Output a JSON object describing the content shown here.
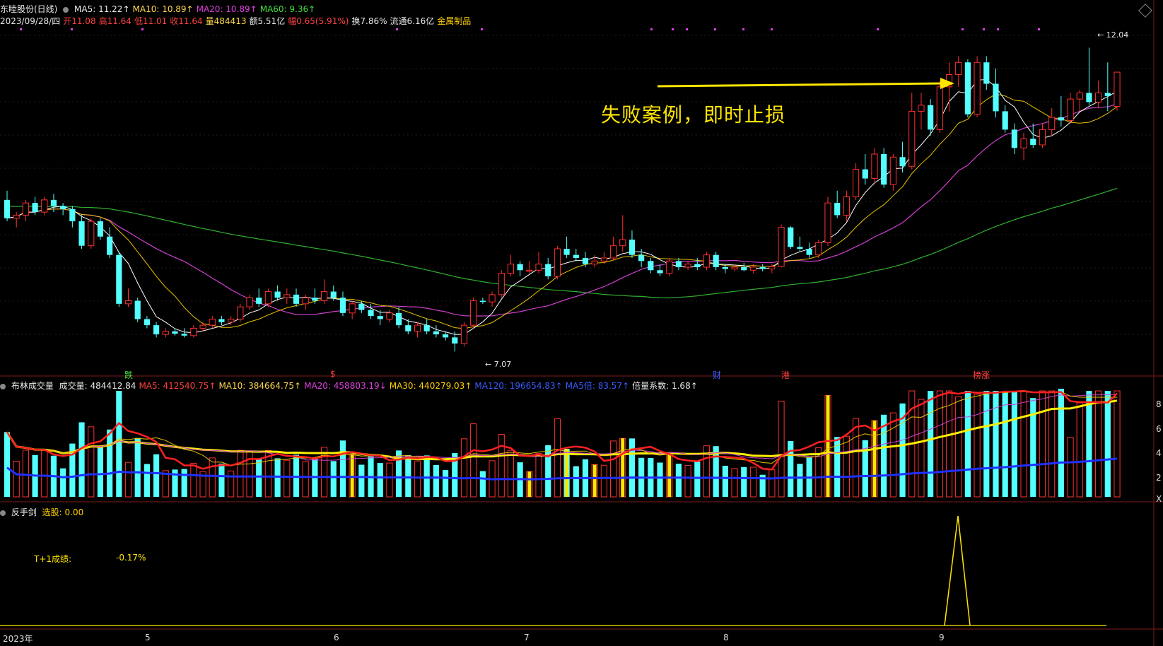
{
  "header": {
    "stock_title": "东睦股份(日线)",
    "ma_items": [
      {
        "label": "MA5: 11.22",
        "color": "#e8e8e8",
        "arrow": "↑"
      },
      {
        "label": "MA10: 10.89",
        "color": "#ffd84a",
        "arrow": "↑"
      },
      {
        "label": "MA20: 10.89",
        "color": "#e040e0",
        "arrow": "↑"
      },
      {
        "label": "MA60: 9.36",
        "color": "#40e040",
        "arrow": "↑"
      }
    ],
    "info_line": {
      "date": "2023/09/28/四",
      "open": "开11.08",
      "high": "高11.64",
      "low": "低11.01",
      "close": "收11.64",
      "volume": "量484413",
      "amount": "额5.51亿",
      "change": "幅0.65(5.91%)",
      "turnover": "换7.86%",
      "float": "流通6.16亿",
      "sector": "金属制品"
    }
  },
  "volume_header": {
    "name": "布林成交量",
    "items": [
      {
        "label": "成交量: 484412.84",
        "color": "#e8e8e8",
        "arrow": ""
      },
      {
        "label": "MA5: 412540.75",
        "color": "#ff4040",
        "arrow": "↑"
      },
      {
        "label": "MA10: 384664.75",
        "color": "#ffd84a",
        "arrow": "↑"
      },
      {
        "label": "MA20: 458803.19",
        "color": "#e040e0",
        "arrow": "↓"
      },
      {
        "label": "MA30: 440279.03",
        "color": "#ffd000",
        "arrow": "↑"
      },
      {
        "label": "MA120: 196654.83",
        "color": "#3a5cff",
        "arrow": "↑"
      },
      {
        "label": "MA5倍: 83.57",
        "color": "#3a5cff",
        "arrow": "↑"
      },
      {
        "label": "倍量系数: 1.68",
        "color": "#e8e8e8",
        "arrow": "↑"
      }
    ]
  },
  "indicator_header": {
    "name": "反手剑",
    "value": "选股: 0.00"
  },
  "annotation": "失败案例，即时止损",
  "performance": {
    "label": "T+1成绩:",
    "value": "-0.17%"
  },
  "price_marks": {
    "high": "12.04",
    "low": "7.07"
  },
  "event_tags": [
    {
      "text": "跌",
      "color": "#40e040"
    },
    {
      "text": "$",
      "color": "#ff4040"
    },
    {
      "text": "财",
      "color": "#3a5cff"
    },
    {
      "text": "港",
      "color": "#ff4040"
    },
    {
      "text": "榜涨",
      "color": "#ff4040"
    }
  ],
  "x_axis_labels": [
    "2023年",
    "5",
    "6",
    "7",
    "8",
    "9"
  ],
  "right_axis_labels": [
    "8",
    "6",
    "4",
    "2",
    "X"
  ],
  "colors": {
    "up": "#ff3030",
    "down": "#54ffff",
    "ma5": "#ffffff",
    "ma10": "#e8c400",
    "ma20": "#d040d0",
    "ma60": "#30b030",
    "annotation": "#ffe600"
  },
  "chart_data": {
    "type": "candlestick",
    "date_range": [
      "2023-04",
      "2023-09-28"
    ],
    "price_range": [
      7.07,
      12.04
    ],
    "last_close": 11.64,
    "candles": [
      {
        "o": 9.55,
        "h": 9.7,
        "l": 9.2,
        "c": 9.25
      },
      {
        "o": 9.25,
        "h": 9.35,
        "l": 9.1,
        "c": 9.3
      },
      {
        "o": 9.3,
        "h": 9.55,
        "l": 9.2,
        "c": 9.5
      },
      {
        "o": 9.5,
        "h": 9.6,
        "l": 9.3,
        "c": 9.35
      },
      {
        "o": 9.35,
        "h": 9.6,
        "l": 9.3,
        "c": 9.55
      },
      {
        "o": 9.55,
        "h": 9.65,
        "l": 9.35,
        "c": 9.45
      },
      {
        "o": 9.45,
        "h": 9.5,
        "l": 9.3,
        "c": 9.4
      },
      {
        "o": 9.4,
        "h": 9.45,
        "l": 9.1,
        "c": 9.2
      },
      {
        "o": 9.2,
        "h": 9.3,
        "l": 8.75,
        "c": 8.8
      },
      {
        "o": 8.8,
        "h": 9.25,
        "l": 8.75,
        "c": 9.2
      },
      {
        "o": 9.2,
        "h": 9.25,
        "l": 8.9,
        "c": 8.95
      },
      {
        "o": 8.95,
        "h": 9.1,
        "l": 8.6,
        "c": 8.65
      },
      {
        "o": 8.65,
        "h": 8.7,
        "l": 7.8,
        "c": 7.85
      },
      {
        "o": 7.85,
        "h": 8.1,
        "l": 7.8,
        "c": 7.9
      },
      {
        "o": 7.9,
        "h": 7.95,
        "l": 7.55,
        "c": 7.6
      },
      {
        "o": 7.6,
        "h": 7.65,
        "l": 7.45,
        "c": 7.5
      },
      {
        "o": 7.5,
        "h": 7.55,
        "l": 7.3,
        "c": 7.35
      },
      {
        "o": 7.35,
        "h": 7.45,
        "l": 7.3,
        "c": 7.4
      },
      {
        "o": 7.4,
        "h": 7.45,
        "l": 7.33,
        "c": 7.36
      },
      {
        "o": 7.36,
        "h": 7.45,
        "l": 7.3,
        "c": 7.33
      },
      {
        "o": 7.33,
        "h": 7.5,
        "l": 7.3,
        "c": 7.45
      },
      {
        "o": 7.45,
        "h": 7.55,
        "l": 7.4,
        "c": 7.5
      },
      {
        "o": 7.5,
        "h": 7.65,
        "l": 7.45,
        "c": 7.6
      },
      {
        "o": 7.6,
        "h": 7.65,
        "l": 7.5,
        "c": 7.55
      },
      {
        "o": 7.55,
        "h": 7.65,
        "l": 7.5,
        "c": 7.6
      },
      {
        "o": 7.6,
        "h": 7.85,
        "l": 7.55,
        "c": 7.8
      },
      {
        "o": 7.8,
        "h": 8.0,
        "l": 7.75,
        "c": 7.95
      },
      {
        "o": 7.95,
        "h": 8.1,
        "l": 7.8,
        "c": 7.85
      },
      {
        "o": 7.85,
        "h": 8.1,
        "l": 7.8,
        "c": 8.05
      },
      {
        "o": 8.05,
        "h": 8.15,
        "l": 7.9,
        "c": 7.95
      },
      {
        "o": 7.95,
        "h": 8.1,
        "l": 7.85,
        "c": 8.0
      },
      {
        "o": 8.0,
        "h": 8.1,
        "l": 7.8,
        "c": 7.85
      },
      {
        "o": 7.85,
        "h": 8.0,
        "l": 7.75,
        "c": 7.95
      },
      {
        "o": 7.95,
        "h": 8.1,
        "l": 7.85,
        "c": 7.9
      },
      {
        "o": 7.9,
        "h": 8.25,
        "l": 7.85,
        "c": 8.05
      },
      {
        "o": 8.05,
        "h": 8.15,
        "l": 7.9,
        "c": 7.95
      },
      {
        "o": 7.95,
        "h": 8.05,
        "l": 7.65,
        "c": 7.7
      },
      {
        "o": 7.7,
        "h": 7.9,
        "l": 7.6,
        "c": 7.85
      },
      {
        "o": 7.85,
        "h": 7.9,
        "l": 7.7,
        "c": 7.75
      },
      {
        "o": 7.75,
        "h": 7.85,
        "l": 7.6,
        "c": 7.65
      },
      {
        "o": 7.65,
        "h": 7.75,
        "l": 7.5,
        "c": 7.6
      },
      {
        "o": 7.6,
        "h": 7.75,
        "l": 7.55,
        "c": 7.7
      },
      {
        "o": 7.7,
        "h": 7.8,
        "l": 7.45,
        "c": 7.5
      },
      {
        "o": 7.5,
        "h": 7.6,
        "l": 7.35,
        "c": 7.4
      },
      {
        "o": 7.4,
        "h": 7.55,
        "l": 7.3,
        "c": 7.5
      },
      {
        "o": 7.5,
        "h": 7.6,
        "l": 7.35,
        "c": 7.4
      },
      {
        "o": 7.4,
        "h": 7.5,
        "l": 7.3,
        "c": 7.35
      },
      {
        "o": 7.35,
        "h": 7.4,
        "l": 7.25,
        "c": 7.3
      },
      {
        "o": 7.3,
        "h": 7.4,
        "l": 7.07,
        "c": 7.2
      },
      {
        "o": 7.2,
        "h": 7.55,
        "l": 7.15,
        "c": 7.5
      },
      {
        "o": 7.5,
        "h": 7.95,
        "l": 7.45,
        "c": 7.9
      },
      {
        "o": 7.9,
        "h": 7.95,
        "l": 7.85,
        "c": 7.88
      },
      {
        "o": 7.88,
        "h": 8.05,
        "l": 7.8,
        "c": 8.0
      },
      {
        "o": 8.0,
        "h": 8.4,
        "l": 7.95,
        "c": 8.35
      },
      {
        "o": 8.35,
        "h": 8.65,
        "l": 8.3,
        "c": 8.5
      },
      {
        "o": 8.5,
        "h": 8.55,
        "l": 8.3,
        "c": 8.4
      },
      {
        "o": 8.4,
        "h": 8.55,
        "l": 8.35,
        "c": 8.4
      },
      {
        "o": 8.4,
        "h": 8.7,
        "l": 8.35,
        "c": 8.5
      },
      {
        "o": 8.5,
        "h": 8.6,
        "l": 8.25,
        "c": 8.3
      },
      {
        "o": 8.3,
        "h": 8.8,
        "l": 8.25,
        "c": 8.75
      },
      {
        "o": 8.75,
        "h": 8.95,
        "l": 8.6,
        "c": 8.65
      },
      {
        "o": 8.65,
        "h": 8.75,
        "l": 8.55,
        "c": 8.6
      },
      {
        "o": 8.6,
        "h": 8.7,
        "l": 8.45,
        "c": 8.5
      },
      {
        "o": 8.5,
        "h": 8.65,
        "l": 8.45,
        "c": 8.55
      },
      {
        "o": 8.55,
        "h": 8.7,
        "l": 8.5,
        "c": 8.6
      },
      {
        "o": 8.6,
        "h": 8.95,
        "l": 8.55,
        "c": 8.8
      },
      {
        "o": 8.8,
        "h": 9.3,
        "l": 8.7,
        "c": 8.9
      },
      {
        "o": 8.9,
        "h": 9.05,
        "l": 8.6,
        "c": 8.65
      },
      {
        "o": 8.65,
        "h": 8.75,
        "l": 8.45,
        "c": 8.55
      },
      {
        "o": 8.55,
        "h": 8.6,
        "l": 8.35,
        "c": 8.4
      },
      {
        "o": 8.4,
        "h": 8.5,
        "l": 8.3,
        "c": 8.35
      },
      {
        "o": 8.35,
        "h": 8.6,
        "l": 8.3,
        "c": 8.55
      },
      {
        "o": 8.55,
        "h": 8.6,
        "l": 8.4,
        "c": 8.45
      },
      {
        "o": 8.45,
        "h": 8.55,
        "l": 8.4,
        "c": 8.5
      },
      {
        "o": 8.5,
        "h": 8.6,
        "l": 8.4,
        "c": 8.45
      },
      {
        "o": 8.45,
        "h": 8.7,
        "l": 8.4,
        "c": 8.65
      },
      {
        "o": 8.65,
        "h": 8.7,
        "l": 8.4,
        "c": 8.45
      },
      {
        "o": 8.45,
        "h": 8.5,
        "l": 8.35,
        "c": 8.42
      },
      {
        "o": 8.42,
        "h": 8.5,
        "l": 8.38,
        "c": 8.45
      },
      {
        "o": 8.45,
        "h": 8.52,
        "l": 8.38,
        "c": 8.4
      },
      {
        "o": 8.4,
        "h": 8.5,
        "l": 8.35,
        "c": 8.45
      },
      {
        "o": 8.45,
        "h": 8.5,
        "l": 8.38,
        "c": 8.42
      },
      {
        "o": 8.42,
        "h": 8.5,
        "l": 8.35,
        "c": 8.46
      },
      {
        "o": 8.46,
        "h": 9.15,
        "l": 8.45,
        "c": 9.1
      },
      {
        "o": 9.1,
        "h": 9.12,
        "l": 8.75,
        "c": 8.78
      },
      {
        "o": 8.78,
        "h": 8.95,
        "l": 8.7,
        "c": 8.75
      },
      {
        "o": 8.75,
        "h": 8.85,
        "l": 8.6,
        "c": 8.65
      },
      {
        "o": 8.65,
        "h": 8.9,
        "l": 8.6,
        "c": 8.85
      },
      {
        "o": 8.85,
        "h": 9.6,
        "l": 8.8,
        "c": 9.5
      },
      {
        "o": 9.5,
        "h": 9.7,
        "l": 9.25,
        "c": 9.3
      },
      {
        "o": 9.3,
        "h": 9.7,
        "l": 9.2,
        "c": 9.6
      },
      {
        "o": 9.6,
        "h": 10.15,
        "l": 9.55,
        "c": 10.05
      },
      {
        "o": 10.05,
        "h": 10.3,
        "l": 9.8,
        "c": 9.9
      },
      {
        "o": 9.9,
        "h": 10.4,
        "l": 9.8,
        "c": 10.3
      },
      {
        "o": 10.3,
        "h": 10.4,
        "l": 9.75,
        "c": 9.8
      },
      {
        "o": 9.8,
        "h": 10.3,
        "l": 9.7,
        "c": 10.25
      },
      {
        "o": 10.25,
        "h": 10.5,
        "l": 10.0,
        "c": 10.1
      },
      {
        "o": 10.1,
        "h": 11.3,
        "l": 10.05,
        "c": 11.0
      },
      {
        "o": 11.0,
        "h": 11.3,
        "l": 10.7,
        "c": 11.1
      },
      {
        "o": 11.1,
        "h": 11.2,
        "l": 10.6,
        "c": 10.7
      },
      {
        "o": 10.7,
        "h": 11.5,
        "l": 10.65,
        "c": 11.4
      },
      {
        "o": 11.4,
        "h": 11.8,
        "l": 11.0,
        "c": 11.6
      },
      {
        "o": 11.6,
        "h": 11.9,
        "l": 11.4,
        "c": 11.8
      },
      {
        "o": 11.8,
        "h": 11.85,
        "l": 10.9,
        "c": 10.95
      },
      {
        "o": 10.95,
        "h": 11.9,
        "l": 10.9,
        "c": 11.8
      },
      {
        "o": 11.8,
        "h": 11.9,
        "l": 11.35,
        "c": 11.45
      },
      {
        "o": 11.45,
        "h": 11.7,
        "l": 10.9,
        "c": 11.0
      },
      {
        "o": 11.0,
        "h": 11.1,
        "l": 10.65,
        "c": 10.7
      },
      {
        "o": 10.7,
        "h": 10.8,
        "l": 10.3,
        "c": 10.4
      },
      {
        "o": 10.4,
        "h": 10.65,
        "l": 10.2,
        "c": 10.55
      },
      {
        "o": 10.55,
        "h": 10.8,
        "l": 10.4,
        "c": 10.45
      },
      {
        "o": 10.45,
        "h": 10.8,
        "l": 10.4,
        "c": 10.7
      },
      {
        "o": 10.7,
        "h": 11.05,
        "l": 10.6,
        "c": 10.9
      },
      {
        "o": 10.9,
        "h": 11.25,
        "l": 10.75,
        "c": 10.85
      },
      {
        "o": 10.85,
        "h": 11.3,
        "l": 10.8,
        "c": 11.2
      },
      {
        "o": 11.2,
        "h": 11.35,
        "l": 11.0,
        "c": 11.3
      },
      {
        "o": 11.3,
        "h": 12.04,
        "l": 11.1,
        "c": 11.15
      },
      {
        "o": 11.15,
        "h": 11.5,
        "l": 11.05,
        "c": 11.3
      },
      {
        "o": 11.3,
        "h": 11.8,
        "l": 11.0,
        "c": 11.25
      },
      {
        "o": 11.08,
        "h": 11.64,
        "l": 11.01,
        "c": 11.64
      }
    ]
  }
}
